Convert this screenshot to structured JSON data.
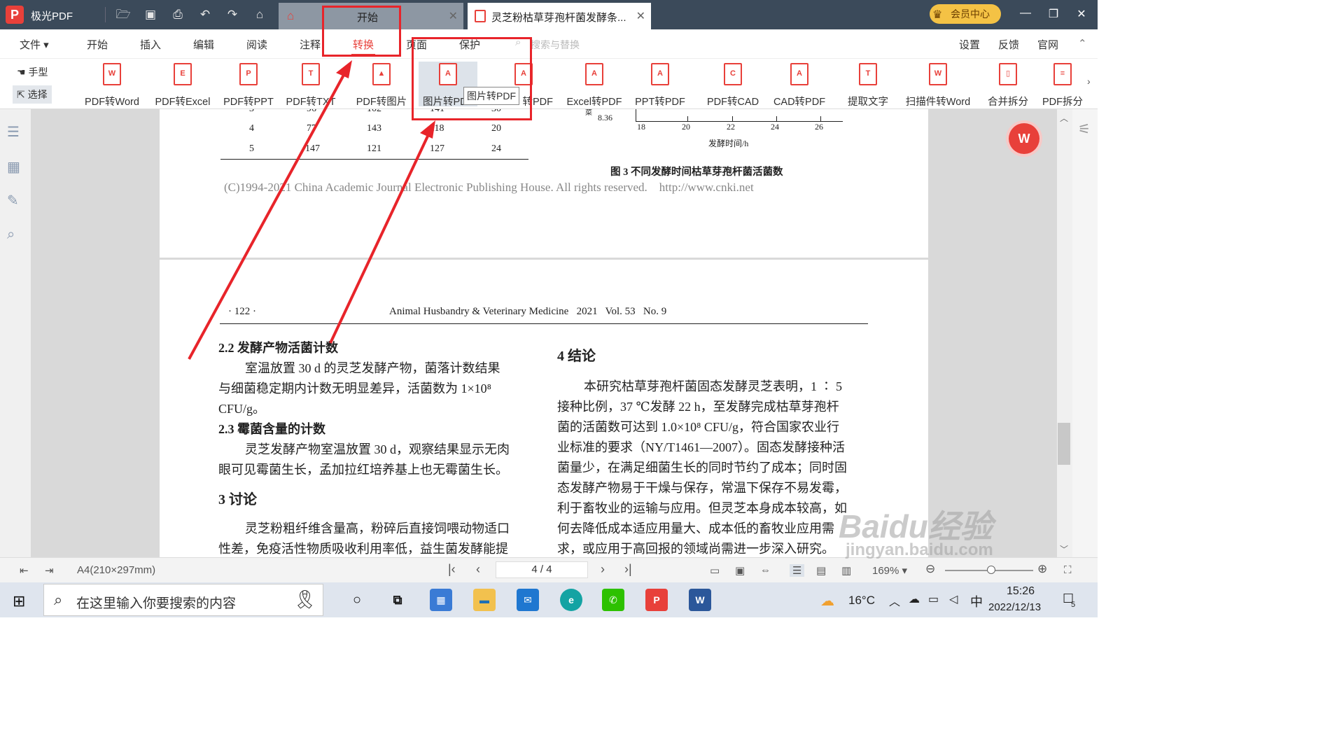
{
  "app": {
    "name": "极光PDF",
    "logo_letter": "P"
  },
  "tabs": [
    {
      "label": "开始"
    },
    {
      "label": "灵芝粉枯草芽孢杆菌发酵条..."
    }
  ],
  "vip": {
    "label": "会员中心"
  },
  "menu": {
    "file": "文件",
    "items": [
      "开始",
      "插入",
      "编辑",
      "阅读",
      "注释",
      "转换",
      "页面",
      "保护"
    ],
    "active": "转换",
    "search_placeholder": "搜索与替换",
    "right": [
      "设置",
      "反馈",
      "官网"
    ]
  },
  "modes": {
    "hand": "手型",
    "select": "选择"
  },
  "tools": [
    {
      "label": "PDF转Word",
      "glyph": "W"
    },
    {
      "label": "PDF转Excel",
      "glyph": "E"
    },
    {
      "label": "PDF转PPT",
      "glyph": "P"
    },
    {
      "label": "PDF转TXT",
      "glyph": "T"
    },
    {
      "label": "PDF转图片",
      "glyph": "▲"
    },
    {
      "label": "图片转PDF",
      "glyph": "A"
    },
    {
      "label": "转PDF",
      "glyph": "A"
    },
    {
      "label": "Excel转PDF",
      "glyph": "A"
    },
    {
      "label": "PPT转PDF",
      "glyph": "A"
    },
    {
      "label": "PDF转CAD",
      "glyph": "C"
    },
    {
      "label": "CAD转PDF",
      "glyph": "A"
    },
    {
      "label": "提取文字",
      "glyph": "T"
    },
    {
      "label": "扫描件转Word",
      "glyph": "W"
    },
    {
      "label": "合并拆分",
      "glyph": "▯"
    },
    {
      "label": "PDF拆分",
      "glyph": "≡"
    }
  ],
  "tooltip": "图片转PDF",
  "doc": {
    "table_rows": [
      {
        "c1": "3",
        "c2": "96",
        "c3": "102",
        "c4": "141",
        "c5": "30"
      },
      {
        "c1": "4",
        "c2": "77",
        "c3": "143",
        "c4": "118",
        "c5": "20"
      },
      {
        "c1": "5",
        "c2": "147",
        "c3": "121",
        "c4": "127",
        "c5": "24"
      }
    ],
    "chart_y_tick": "8.36",
    "chart_x_ticks": [
      "18",
      "20",
      "22",
      "24",
      "26"
    ],
    "chart_xlabel": "发酵时间/h",
    "chart_ylabel_frag": "菜",
    "figure_caption": "图 3   不同发酵时间枯草芽孢杆菌活菌数",
    "copyright": "(C)1994-2021 China Academic Journal Electronic Publishing House. All rights reserved.    http://www.cnki.net",
    "page_no": "· 122 ·",
    "journal": "Animal Husbandry & Veterinary Medicine   2021   Vol. 53   No. 9",
    "h22": "2.2   发酵产物活菌计数",
    "p22a": "室温放置 30 d 的灵芝发酵产物，菌落计数结果",
    "p22b": "与细菌稳定期内计数无明显差异，活菌数为 1×10⁸",
    "p22c": "CFU/g。",
    "h23": "2.3   霉菌含量的计数",
    "p23a": "灵芝发酵产物室温放置 30 d，观察结果显示无肉",
    "p23b": "眼可见霉菌生长，孟加拉红培养基上也无霉菌生长。",
    "h3": "3   讨论",
    "p3a": "灵芝粉粗纤维含量高，粉碎后直接饲喂动物适口",
    "p3b": "性差，免疫活性物质吸收利用率低，益生菌发酵能提",
    "h4": "4   结论",
    "p4": [
      "本研究枯草芽孢杆菌固态发酵灵芝表明，1 ∶ 5",
      "接种比例，37 ℃发酵 22 h，至发酵完成枯草芽孢杆",
      "菌的活菌数可达到 1.0×10⁸ CFU/g，符合国家农业行",
      "业标准的要求（NY/T1461—2007）。固态发酵接种活",
      "菌量少，在满足细菌生长的同时节约了成本；同时固",
      "态发酵产物易于干燥与保存，常温下保存不易发霉，",
      "利于畜牧业的运输与应用。但灵芝本身成本较高，如",
      "何去降低成本适应用量大、成本低的畜牧业应用需",
      "求，或应用于高回报的领域尚需进一步深入研究。"
    ]
  },
  "status": {
    "paper": "A4(210×297mm)",
    "page": "4 / 4",
    "zoom": "169%"
  },
  "taskbar": {
    "search_placeholder": "在这里输入你要搜索的内容",
    "temp": "16°C",
    "ime": "中",
    "time": "15:26",
    "date": "2022/12/13",
    "notif": "5"
  },
  "watermark": {
    "line1": "Baidu经验",
    "line2": "jingyan.baidu.com"
  },
  "colors": {
    "accent": "#e8403a",
    "titlebar": "#3b4a5a",
    "annotation": "#e8242a"
  }
}
